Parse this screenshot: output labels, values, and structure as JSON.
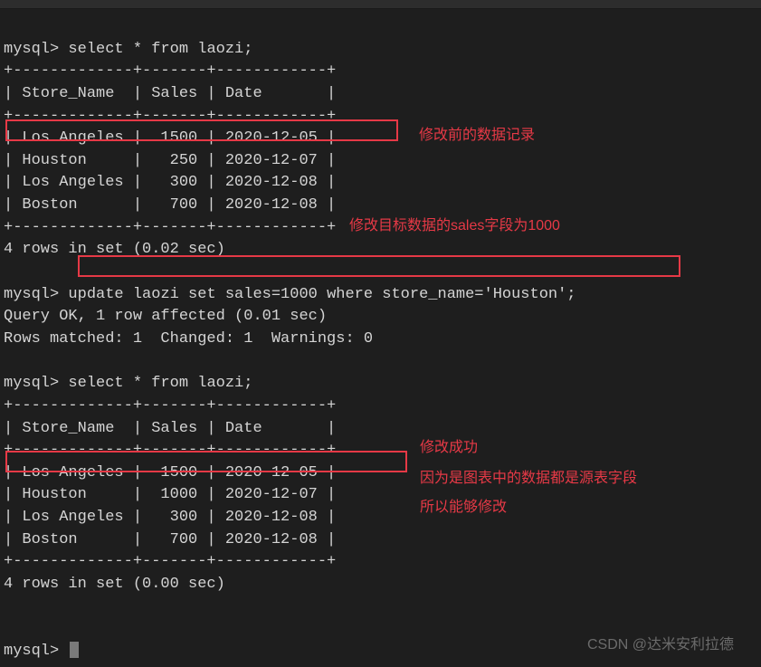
{
  "prompt": "mysql>",
  "queries": {
    "select1": "select * from laozi;",
    "update": "update laozi set sales=1000 where store_name='Houston';",
    "select2": "select * from laozi;"
  },
  "results": {
    "queryok": "Query OK, 1 row affected (0.01 sec)",
    "matched": "Rows matched: 1  Changed: 1  Warnings: 0",
    "rowcount1": "4 rows in set (0.02 sec)",
    "rowcount2": "4 rows in set (0.00 sec)"
  },
  "table1": {
    "sep": "+-------------+-------+------------+",
    "header": "| Store_Name  | Sales | Date       |",
    "rows": [
      "| Los Angeles |  1500 | 2020-12-05 |",
      "| Houston     |   250 | 2020-12-07 |",
      "| Los Angeles |   300 | 2020-12-08 |",
      "| Boston      |   700 | 2020-12-08 |"
    ]
  },
  "table2": {
    "sep": "+-------------+-------+------------+",
    "header": "| Store_Name  | Sales | Date       |",
    "rows": [
      "| Los Angeles |  1500 | 2020-12-05 |",
      "| Houston     |  1000 | 2020-12-07 |",
      "| Los Angeles |   300 | 2020-12-08 |",
      "| Boston      |   700 | 2020-12-08 |"
    ]
  },
  "annotations": {
    "a1": "修改前的数据记录",
    "a2": "修改目标数据的sales字段为1000",
    "a3": "修改成功",
    "a4": "因为是图表中的数据都是源表字段",
    "a5": "所以能够修改"
  },
  "watermark": "CSDN @达米安利拉德"
}
